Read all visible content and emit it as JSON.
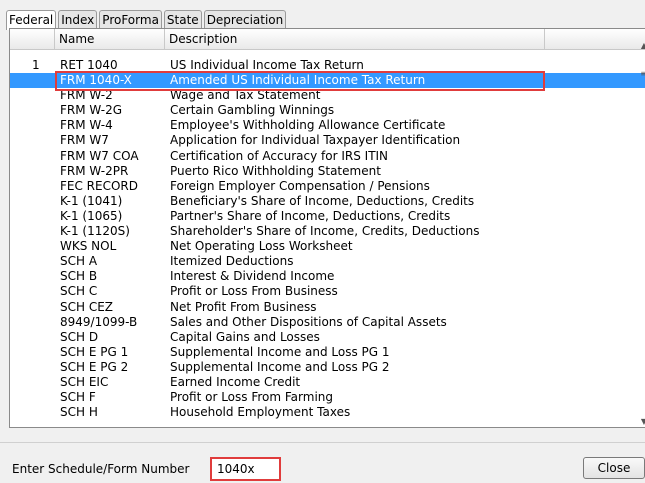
{
  "tabs": [
    {
      "label": "Federal"
    },
    {
      "label": "Index"
    },
    {
      "label": "ProForma"
    },
    {
      "label": "State"
    },
    {
      "label": "Depreciation"
    }
  ],
  "columns": {
    "name": "Name",
    "description": "Description"
  },
  "rows": [
    {
      "num": "1",
      "name": "RET 1040",
      "desc": "US Individual Income Tax Return"
    },
    {
      "num": "",
      "name": "FRM 1040-X",
      "desc": "Amended US Individual Income Tax Return"
    },
    {
      "num": "",
      "name": "FRM W-2",
      "desc": "Wage and Tax Statement"
    },
    {
      "num": "",
      "name": "FRM W-2G",
      "desc": "Certain Gambling Winnings"
    },
    {
      "num": "",
      "name": "FRM W-4",
      "desc": "Employee's Withholding Allowance Certificate"
    },
    {
      "num": "",
      "name": "FRM W7",
      "desc": "Application for Individual Taxpayer Identification"
    },
    {
      "num": "",
      "name": "FRM W7 COA",
      "desc": "Certification of Accuracy for IRS ITIN"
    },
    {
      "num": "",
      "name": "FRM W-2PR",
      "desc": "Puerto Rico Withholding Statement"
    },
    {
      "num": "",
      "name": "FEC RECORD",
      "desc": "Foreign Employer Compensation / Pensions"
    },
    {
      "num": "",
      "name": "K-1 (1041)",
      "desc": "Beneficiary's Share of Income, Deductions, Credits"
    },
    {
      "num": "",
      "name": "K-1 (1065)",
      "desc": "Partner's Share of Income, Deductions, Credits"
    },
    {
      "num": "",
      "name": "K-1 (1120S)",
      "desc": "Shareholder's Share of Income, Credits, Deductions"
    },
    {
      "num": "",
      "name": "WKS NOL",
      "desc": "Net Operating Loss Worksheet"
    },
    {
      "num": "",
      "name": "SCH A",
      "desc": "Itemized Deductions"
    },
    {
      "num": "",
      "name": "SCH B",
      "desc": "Interest & Dividend Income"
    },
    {
      "num": "",
      "name": "SCH C",
      "desc": "Profit or Loss From Business"
    },
    {
      "num": "",
      "name": "SCH CEZ",
      "desc": "Net Profit From Business"
    },
    {
      "num": "",
      "name": "8949/1099-B",
      "desc": "Sales and Other Dispositions of Capital Assets"
    },
    {
      "num": "",
      "name": "SCH D",
      "desc": "Capital Gains and Losses"
    },
    {
      "num": "",
      "name": "SCH E PG 1",
      "desc": "Supplemental Income and Loss PG 1"
    },
    {
      "num": "",
      "name": "SCH E PG 2",
      "desc": "Supplemental Income and Loss PG 2"
    },
    {
      "num": "",
      "name": "SCH EIC",
      "desc": "Earned Income Credit"
    },
    {
      "num": "",
      "name": "SCH F",
      "desc": "Profit or Loss From Farming"
    },
    {
      "num": "",
      "name": "SCH H",
      "desc": "Household Employment Taxes"
    }
  ],
  "selected_row": 1,
  "icons": {
    "scroll_up": "scroll-up-icon",
    "scroll_grip": "scroll-grip-icon",
    "scroll_down": "scroll-down-icon"
  },
  "footer": {
    "label": "Enter Schedule/Form Number",
    "input_value": "1040x",
    "close_label": "Close"
  },
  "colors": {
    "selection": "#3399ff",
    "highlight_box": "#e03c3c"
  }
}
